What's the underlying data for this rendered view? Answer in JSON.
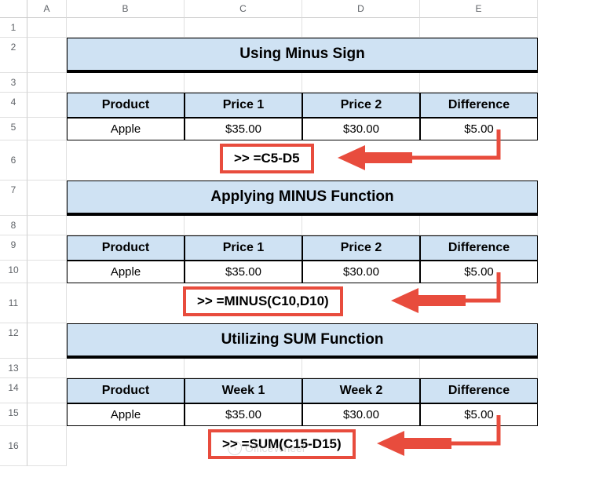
{
  "columns": [
    "",
    "A",
    "B",
    "C",
    "D",
    "E"
  ],
  "rows": [
    "1",
    "2",
    "3",
    "4",
    "5",
    "6",
    "7",
    "8",
    "9",
    "10",
    "11",
    "12",
    "13",
    "14",
    "15",
    "16"
  ],
  "section1": {
    "title": "Using Minus Sign",
    "headers": [
      "Product",
      "Price 1",
      "Price 2",
      "Difference"
    ],
    "data": [
      "Apple",
      "$35.00",
      "$30.00",
      "$5.00"
    ],
    "formula": ">> =C5-D5"
  },
  "section2": {
    "title": "Applying MINUS Function",
    "headers": [
      "Product",
      "Price 1",
      "Price 2",
      "Difference"
    ],
    "data": [
      "Apple",
      "$35.00",
      "$30.00",
      "$5.00"
    ],
    "formula": ">> =MINUS(C10,D10)"
  },
  "section3": {
    "title": "Utilizing SUM Function",
    "headers": [
      "Product",
      "Week 1",
      "Week 2",
      "Difference"
    ],
    "data": [
      "Apple",
      "$35.00",
      "$30.00",
      "$5.00"
    ],
    "formula": ">> =SUM(C15-D15)"
  },
  "watermark": "OfficeWheel"
}
